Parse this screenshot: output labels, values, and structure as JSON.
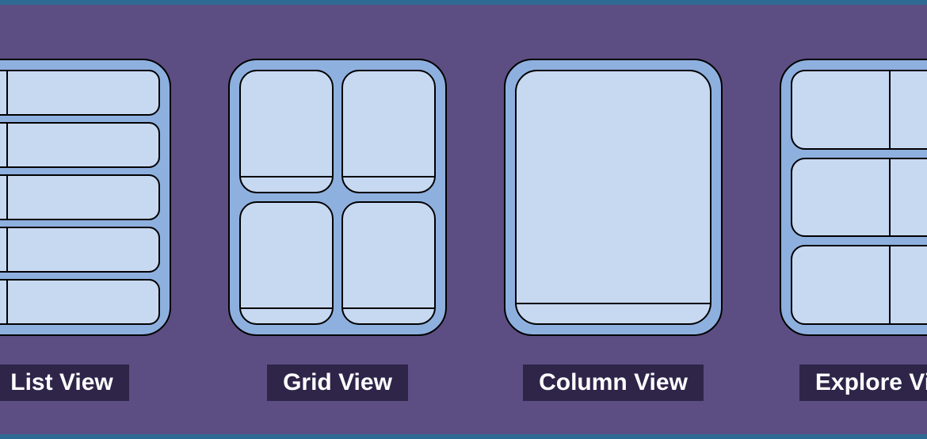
{
  "views": [
    {
      "key": "list",
      "label": "List View"
    },
    {
      "key": "grid",
      "label": "Grid View"
    },
    {
      "key": "column",
      "label": "Column View"
    },
    {
      "key": "explore",
      "label": "Explore View"
    }
  ],
  "colors": {
    "background": "#5c4e82",
    "tile_frame": "#8eb0df",
    "cell_fill": "#c7d8f1",
    "label_bg": "#2e2549",
    "label_text": "#ffffff",
    "border": "#000000",
    "edge_bar": "#2e6a94"
  }
}
